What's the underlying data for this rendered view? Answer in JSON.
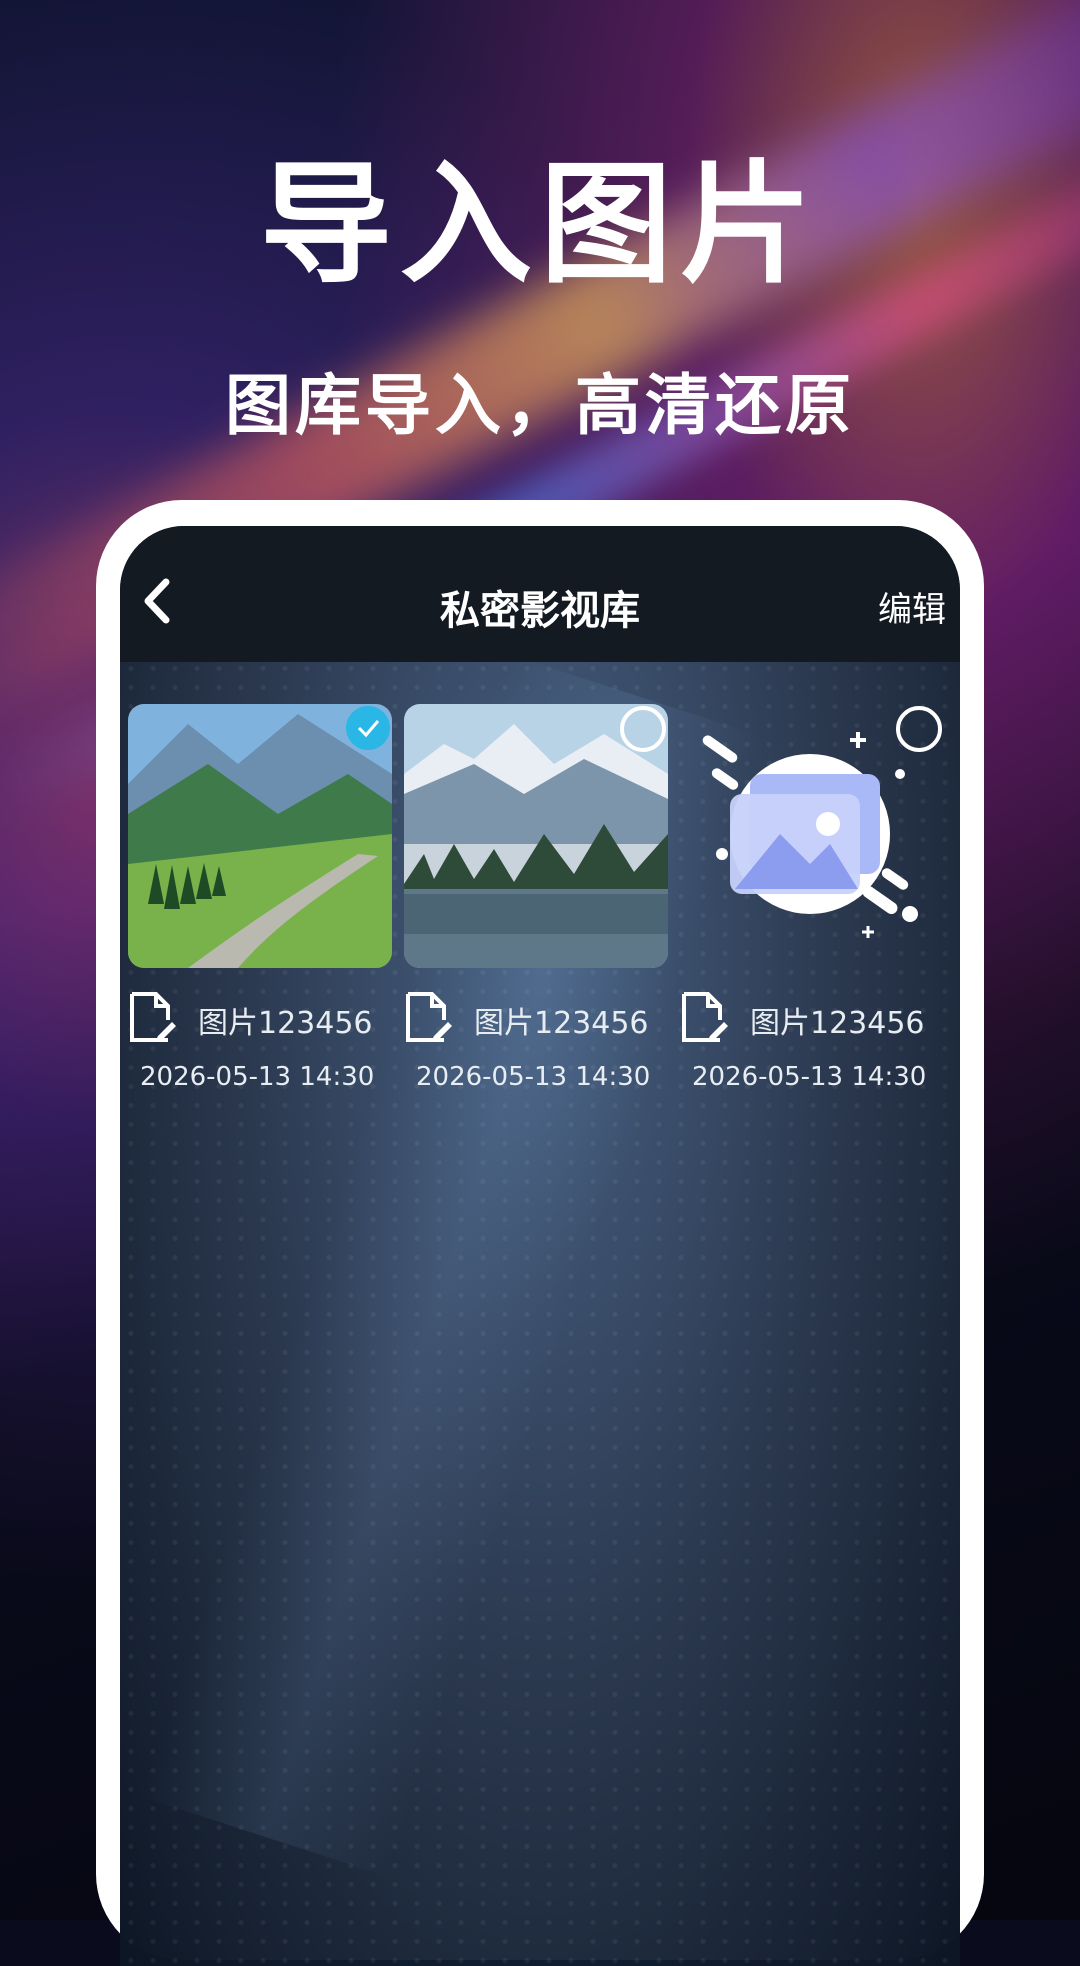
{
  "promo": {
    "headline": "导入图片",
    "subline": "图库导入，高清还原"
  },
  "navbar": {
    "title": "私密影视库",
    "edit_label": "编辑"
  },
  "items": [
    {
      "name": "图片123456",
      "date": "2026-05-13 14:30",
      "selected": true
    },
    {
      "name": "图片123456",
      "date": "2026-05-13 14:30",
      "selected": false
    },
    {
      "name": "图片123456",
      "date": "2026-05-13 14:30",
      "selected": false
    }
  ],
  "colors": {
    "accent": "#2bb7e6",
    "navbar": "#131a22"
  }
}
